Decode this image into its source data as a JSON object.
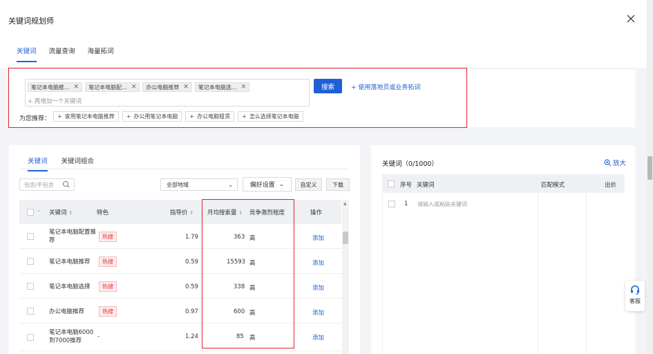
{
  "header": {
    "title": "关键词规划师",
    "tabs": [
      {
        "label": "关键词",
        "active": true
      },
      {
        "label": "流量查询",
        "active": false
      },
      {
        "label": "海量拓词",
        "active": false
      }
    ]
  },
  "search": {
    "chips": [
      "笔记本电脑推...",
      "笔记本电脑配...",
      "办公电脑推荐",
      "笔记本电脑选..."
    ],
    "add_placeholder": "+ 再增加一个关键词",
    "search_button": "搜索",
    "expand_link": "+ 使用落地页或业务拓词",
    "recommend_label": "为您推荐：",
    "recommendations": [
      "家用笔记本电脑推荐",
      "办公用笔记本电脑",
      "办公电脑租赁",
      "怎么选择笔记本电脑"
    ]
  },
  "left_panel": {
    "subtabs": [
      {
        "label": "关键词",
        "active": true
      },
      {
        "label": "关键词组合",
        "active": false
      }
    ],
    "filter_placeholder": "包含/不包含",
    "region": "全部地域",
    "pref_button": "偏好设置",
    "custom_button": "自定义",
    "download_button": "下载",
    "columns": {
      "keyword": "关键词",
      "feature": "特色",
      "price": "指导价",
      "monthly": "月均搜索量",
      "competition": "竞争激烈程度",
      "action": "操作"
    },
    "rows": [
      {
        "keyword": "笔记本电脑配置推荐",
        "feature": "热搜",
        "price": "1.79",
        "monthly": "363",
        "competition": "高",
        "action": "添加"
      },
      {
        "keyword": "笔记本电脑推荐",
        "feature": "热搜",
        "price": "0.59",
        "monthly": "15593",
        "competition": "高",
        "action": "添加"
      },
      {
        "keyword": "笔记本电脑选择",
        "feature": "热搜",
        "price": "0.59",
        "monthly": "338",
        "competition": "高",
        "action": "添加"
      },
      {
        "keyword": "办公电脑推荐",
        "feature": "热搜",
        "price": "0.97",
        "monthly": "600",
        "competition": "高",
        "action": "添加"
      },
      {
        "keyword": "笔记本电脑6000到7000推荐",
        "feature": "-",
        "price": "1.24",
        "monthly": "85",
        "competition": "高",
        "action": "添加"
      }
    ]
  },
  "right_panel": {
    "title": "关键词（0/1000）",
    "zoom": "放大",
    "columns": {
      "index": "序号",
      "keyword": "关键词",
      "match": "匹配模式",
      "bid": "出价"
    },
    "first_row_index": "1",
    "first_row_placeholder": "请输入或粘贴关键词"
  },
  "service": {
    "label": "客服"
  },
  "colors": {
    "accent": "#1f5fd6",
    "highlight": "#e0202a",
    "hot": "#e0323c"
  }
}
